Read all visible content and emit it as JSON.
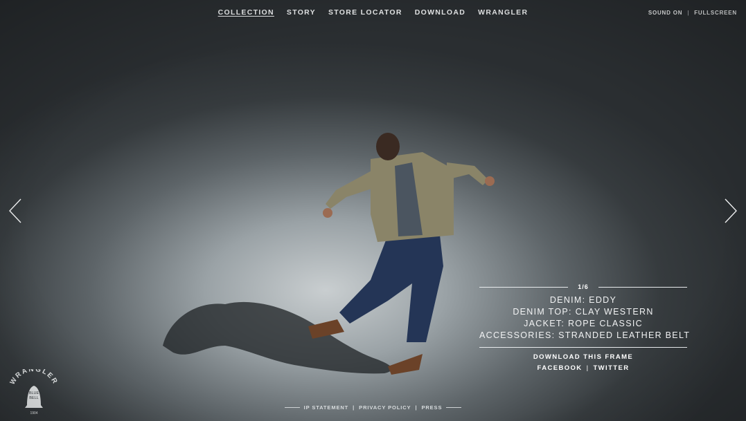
{
  "nav": {
    "items": [
      {
        "label": "COLLECTION"
      },
      {
        "label": "STORY"
      },
      {
        "label": "STORE LOCATOR"
      },
      {
        "label": "DOWNLOAD"
      },
      {
        "label": "WRANGLER"
      }
    ]
  },
  "utility": {
    "sound_label": "SOUND ON",
    "separator": "|",
    "fullscreen_label": "FULLSCREEN"
  },
  "slide": {
    "counter": "1/6",
    "items": [
      "DENIM: EDDY",
      "DENIM TOP: CLAY WESTERN",
      "JACKET: ROPE CLASSIC",
      "ACCESSORIES: STRANDED LEATHER BELT"
    ],
    "download_label": "DOWNLOAD THIS FRAME",
    "facebook_label": "FACEBOOK",
    "separator": "|",
    "twitter_label": "TWITTER"
  },
  "footer": {
    "ip_label": "IP STATEMENT",
    "privacy_label": "PRIVACY POLICY",
    "press_label": "PRESS",
    "separator": "|"
  },
  "logo": {
    "brand": "WRANGLER",
    "bell_text_top": "BLUE",
    "bell_text_bottom": "BELL",
    "year": "1904"
  },
  "icons": {
    "prev": "chevron-left-icon",
    "next": "chevron-right-icon"
  },
  "colors": {
    "spotlight": "#c9ced0",
    "background_dark": "#2a2e31",
    "text": "#eceeef"
  }
}
